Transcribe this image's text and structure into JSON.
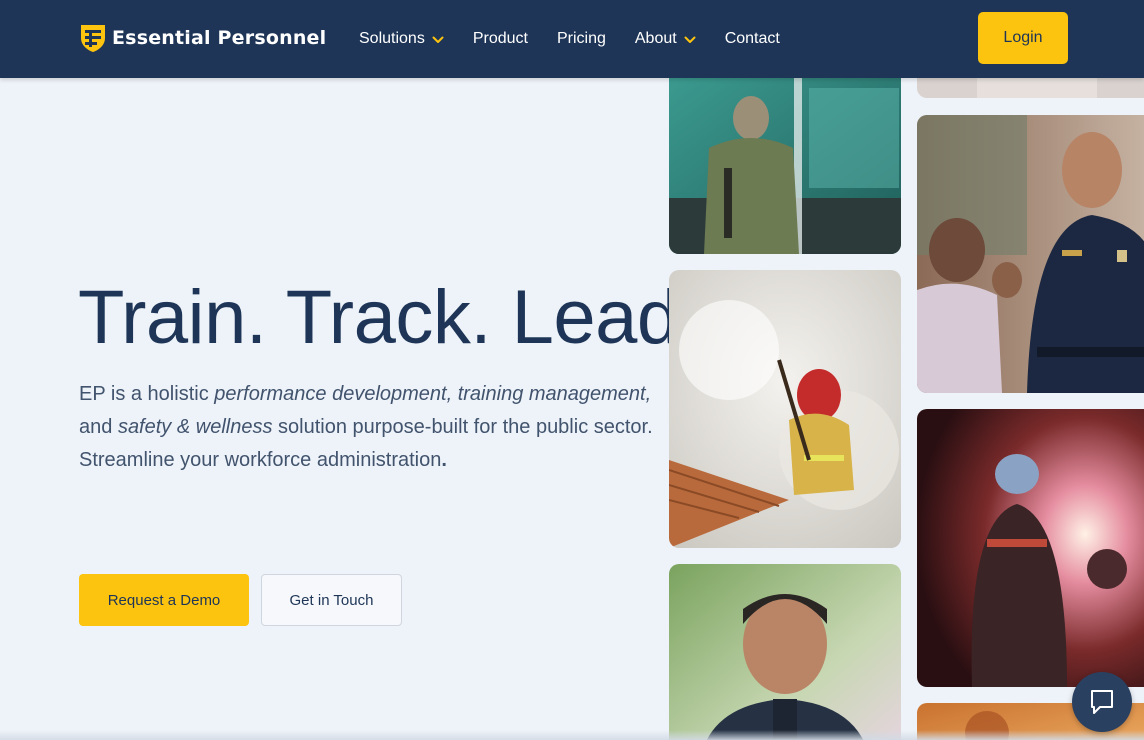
{
  "brand": {
    "name": "Essential Personnel"
  },
  "nav": {
    "items": [
      {
        "label": "Solutions",
        "has_dropdown": true
      },
      {
        "label": "Product",
        "has_dropdown": false
      },
      {
        "label": "Pricing",
        "has_dropdown": false
      },
      {
        "label": "About",
        "has_dropdown": true
      },
      {
        "label": "Contact",
        "has_dropdown": false
      }
    ],
    "login_label": "Login"
  },
  "hero": {
    "headline": "Train. Track. Lead.",
    "desc_intro": "EP is a holistic ",
    "desc_em1": "performance development, training management,",
    "desc_and": " and ",
    "desc_em2": "safety & wellness",
    "desc_rest": " solution purpose-built for the public sector.",
    "desc_line2": "Streamline your workforce administration",
    "desc_line2_end": ".",
    "cta_primary": "Request a Demo",
    "cta_secondary": "Get in Touch"
  },
  "colors": {
    "navy": "#1e3557",
    "accent_yellow": "#fcc40f",
    "background": "#eef3f9"
  },
  "icons": {
    "logo": "shield-logo-icon",
    "dropdown": "chevron-down-icon",
    "chat": "chat-bubble-icon"
  },
  "images": [
    "firefighter-at-truck-photo",
    "firefighter-in-smoke-photo",
    "smiling-police-officer-photo",
    "police-officer-with-community-photo",
    "tunnel-rescue-photo",
    "sunset-scene-photo"
  ]
}
